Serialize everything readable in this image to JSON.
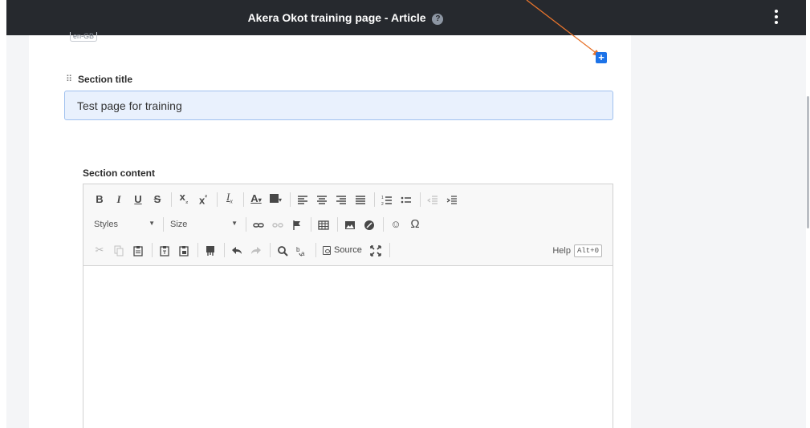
{
  "header": {
    "title": "Akera Okot training page - Article",
    "help_glyph": "?"
  },
  "lang_tag": "en-GB",
  "section": {
    "title_label": "Section title",
    "title_value": "Test page for training",
    "content_label": "Section content"
  },
  "toolbar": {
    "row1": [
      "B",
      "I",
      "U",
      "S",
      "x₂",
      "x²",
      "Ix",
      "A",
      "BG",
      "align-left",
      "align-center",
      "align-right",
      "justify",
      "numbered-list",
      "bullet-list",
      "outdent",
      "indent"
    ],
    "styles_label": "Styles",
    "size_label": "Size",
    "source_label": "Source",
    "help_label": "Help",
    "help_shortcut": "Alt+0",
    "omega": "Ω",
    "smiley": "☺"
  },
  "colors": {
    "topbar": "#26292e",
    "accent": "#1d73e8",
    "input_bg": "#e9f1fd",
    "arrow": "#e8742c"
  }
}
